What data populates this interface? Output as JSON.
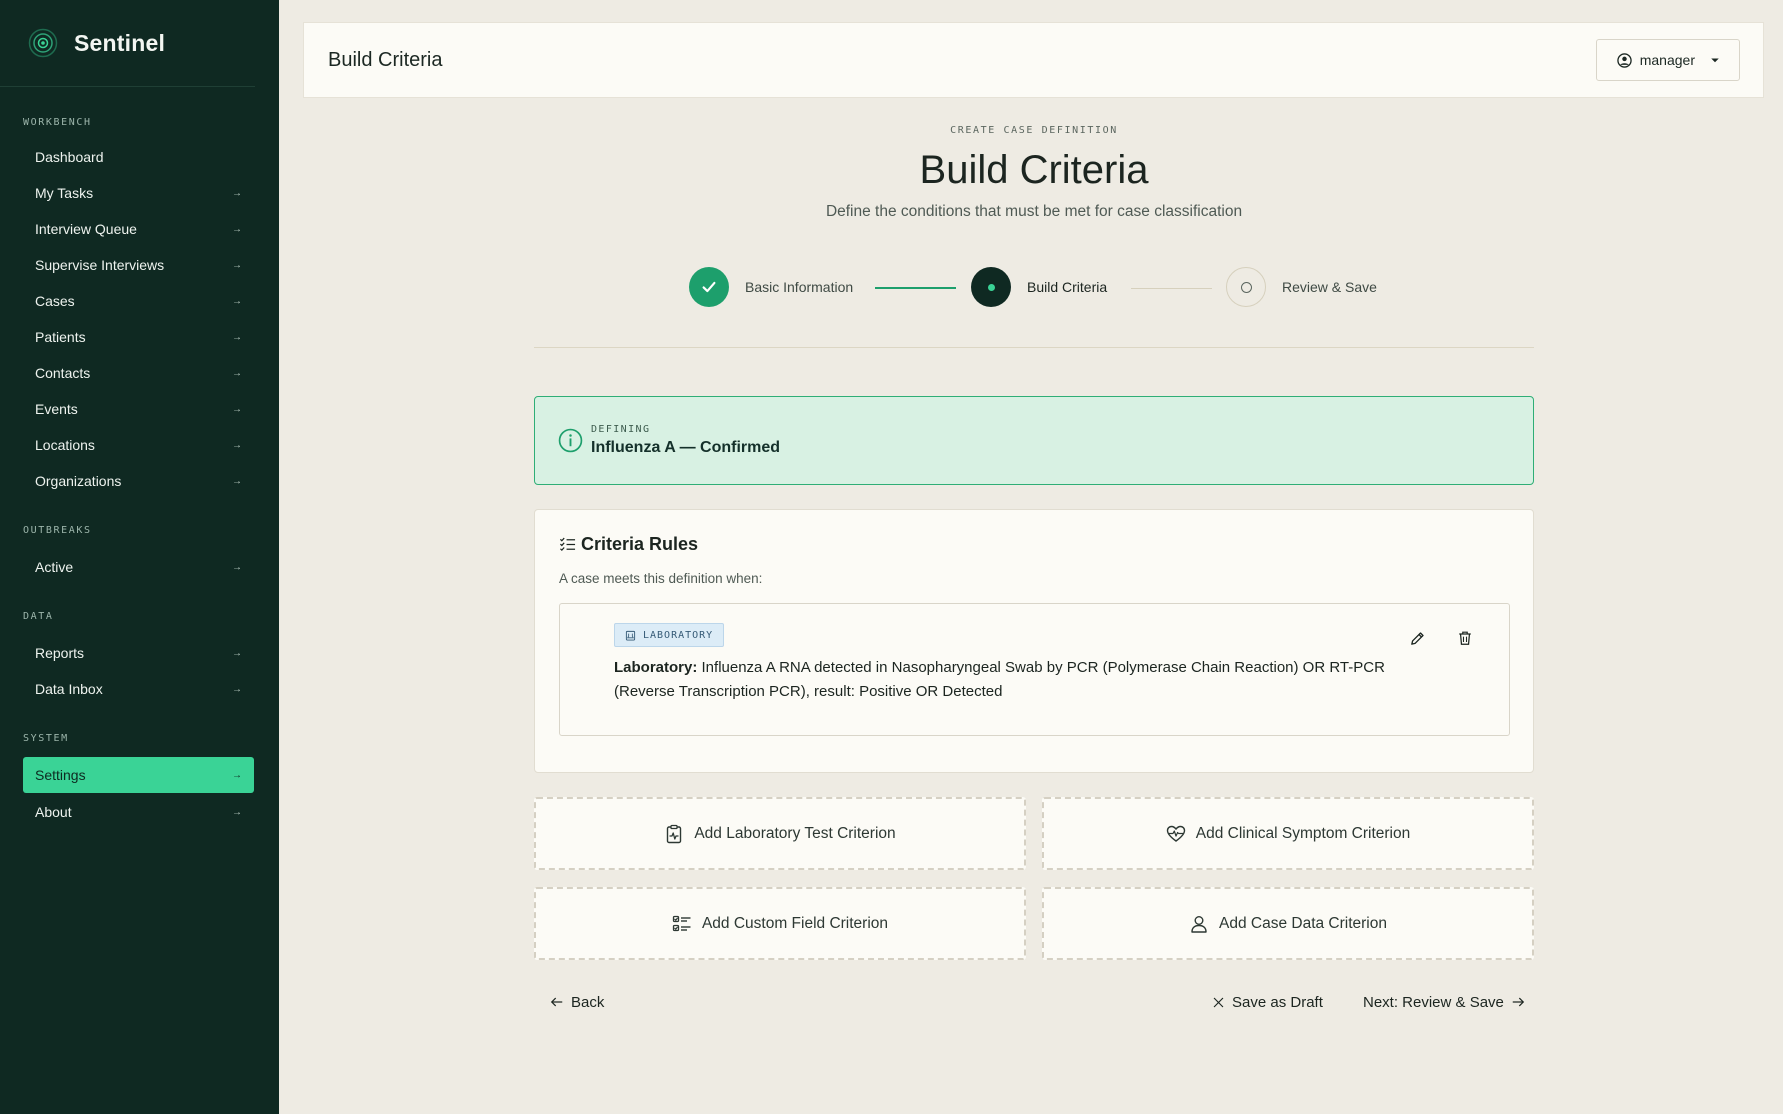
{
  "app": {
    "name": "Sentinel"
  },
  "sidebar": {
    "sections": [
      {
        "heading": "WORKBENCH",
        "items": [
          "Dashboard",
          "My Tasks",
          "Interview Queue",
          "Supervise Interviews",
          "Cases",
          "Patients",
          "Contacts",
          "Events",
          "Locations",
          "Organizations"
        ]
      },
      {
        "heading": "OUTBREAKS",
        "items": [
          "Active"
        ]
      },
      {
        "heading": "DATA",
        "items": [
          "Reports",
          "Data Inbox"
        ]
      },
      {
        "heading": "SYSTEM",
        "items": [
          "Settings",
          "About"
        ]
      }
    ],
    "active_item": "Settings",
    "arrow": "→"
  },
  "header": {
    "title": "Build Criteria",
    "user": "manager"
  },
  "page": {
    "eyebrow": "CREATE CASE DEFINITION",
    "title": "Build Criteria",
    "subtitle": "Define the conditions that must be met for case classification"
  },
  "stepper": {
    "steps": [
      {
        "label": "Basic Information",
        "state": "complete"
      },
      {
        "label": "Build Criteria",
        "state": "current"
      },
      {
        "label": "Review & Save",
        "state": "upcoming"
      }
    ]
  },
  "notice": {
    "tag": "DEFINING",
    "title": "Influenza A — Confirmed"
  },
  "criteria": {
    "title": "Criteria Rules",
    "subtitle": "A case meets this definition when:",
    "rules": [
      {
        "badge": "LABORATORY",
        "label": "Laboratory:",
        "text": "Influenza A RNA detected in Nasopharyngeal Swab by PCR (Polymerase Chain Reaction) OR RT-PCR (Reverse Transcription PCR), result: Positive OR Detected"
      }
    ]
  },
  "add_buttons": {
    "lab": "Add Laboratory Test Criterion",
    "clinical": "Add Clinical Symptom Criterion",
    "custom": "Add Custom Field Criterion",
    "case_data": "Add Case Data Criterion"
  },
  "footer": {
    "back": "Back",
    "draft": "Save as Draft",
    "next": "Next: Review & Save"
  },
  "colors": {
    "sidebar_bg": "#0f2922",
    "accent": "#3ad396",
    "step_done": "#1d9f6c",
    "step_current": "#0f2922"
  }
}
